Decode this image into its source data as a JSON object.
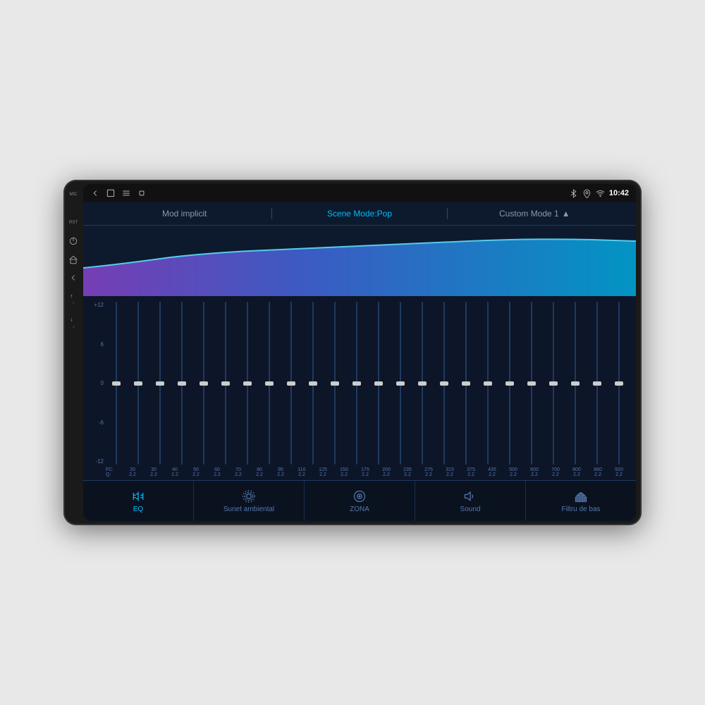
{
  "device": {
    "mic_label": "MIC",
    "rst_label": "RST"
  },
  "status_bar": {
    "time": "10:42",
    "icons": [
      "bluetooth",
      "location",
      "wifi"
    ]
  },
  "mode_bar": {
    "left": "Mod implicit",
    "center": "Scene Mode:Pop",
    "right": "Custom Mode 1",
    "right_icon": "▲"
  },
  "frequencies": [
    {
      "fc": "20",
      "q": "2.2"
    },
    {
      "fc": "30",
      "q": "2.2"
    },
    {
      "fc": "40",
      "q": "2.2"
    },
    {
      "fc": "50",
      "q": "2.2"
    },
    {
      "fc": "60",
      "q": "2.2"
    },
    {
      "fc": "70",
      "q": "2.2"
    },
    {
      "fc": "80",
      "q": "2.2"
    },
    {
      "fc": "95",
      "q": "2.2"
    },
    {
      "fc": "110",
      "q": "2.2"
    },
    {
      "fc": "125",
      "q": "2.2"
    },
    {
      "fc": "150",
      "q": "2.2"
    },
    {
      "fc": "175",
      "q": "2.2"
    },
    {
      "fc": "200",
      "q": "2.2"
    },
    {
      "fc": "235",
      "q": "2.2"
    },
    {
      "fc": "275",
      "q": "2.2"
    },
    {
      "fc": "315",
      "q": "2.2"
    },
    {
      "fc": "375",
      "q": "2.2"
    },
    {
      "fc": "435",
      "q": "2.2"
    },
    {
      "fc": "500",
      "q": "2.2"
    },
    {
      "fc": "600",
      "q": "2.2"
    },
    {
      "fc": "700",
      "q": "2.2"
    },
    {
      "fc": "800",
      "q": "2.2"
    },
    {
      "fc": "860",
      "q": "2.2"
    },
    {
      "fc": "920",
      "q": "2.2"
    }
  ],
  "slider_positions": [
    0.5,
    0.5,
    0.5,
    0.5,
    0.5,
    0.5,
    0.5,
    0.5,
    0.5,
    0.5,
    0.5,
    0.5,
    0.5,
    0.5,
    0.5,
    0.5,
    0.5,
    0.5,
    0.5,
    0.5,
    0.5,
    0.5,
    0.5,
    0.5
  ],
  "db_scale": [
    "+12",
    "6",
    "0",
    "-6",
    "-12"
  ],
  "fc_label": "FC:",
  "q_label": "Q:",
  "nav": {
    "items": [
      {
        "id": "eq",
        "label": "EQ",
        "active": true
      },
      {
        "id": "sunet-ambiental",
        "label": "Sunet ambiental",
        "active": false
      },
      {
        "id": "zona",
        "label": "ZONA",
        "active": false
      },
      {
        "id": "sound",
        "label": "Sound",
        "active": false
      },
      {
        "id": "filtru-de-bas",
        "label": "Filtru de bas",
        "active": false
      }
    ]
  }
}
